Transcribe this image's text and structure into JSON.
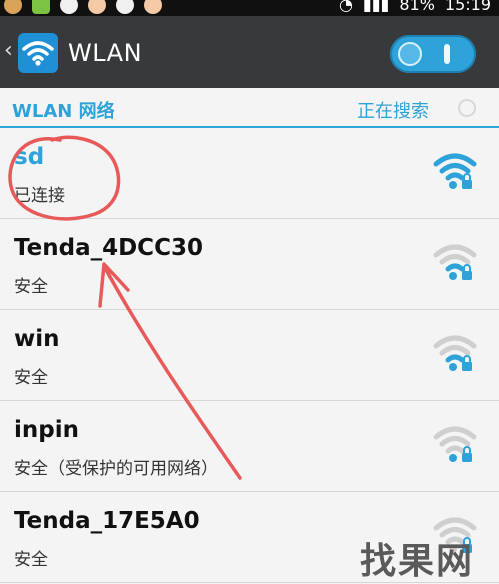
{
  "status_bar": {
    "battery": "81%",
    "time": "15:19"
  },
  "action_bar": {
    "title": "WLAN",
    "toggle_on": true
  },
  "section": {
    "title": "WLAN 网络",
    "status": "正在搜索"
  },
  "networks": [
    {
      "ssid": "sd",
      "status": "已连接",
      "connected": true
    },
    {
      "ssid": "Tenda_4DCC30",
      "status": "安全",
      "connected": false
    },
    {
      "ssid": "win",
      "status": "安全",
      "connected": false
    },
    {
      "ssid": "inpin",
      "status": "安全（受保护的可用网络）",
      "connected": false
    },
    {
      "ssid": "Tenda_17E5A0",
      "status": "安全",
      "connected": false
    }
  ],
  "colors": {
    "accent": "#2ea3d9",
    "action_bar": "#37393b",
    "annotation": "#e85a5a"
  }
}
